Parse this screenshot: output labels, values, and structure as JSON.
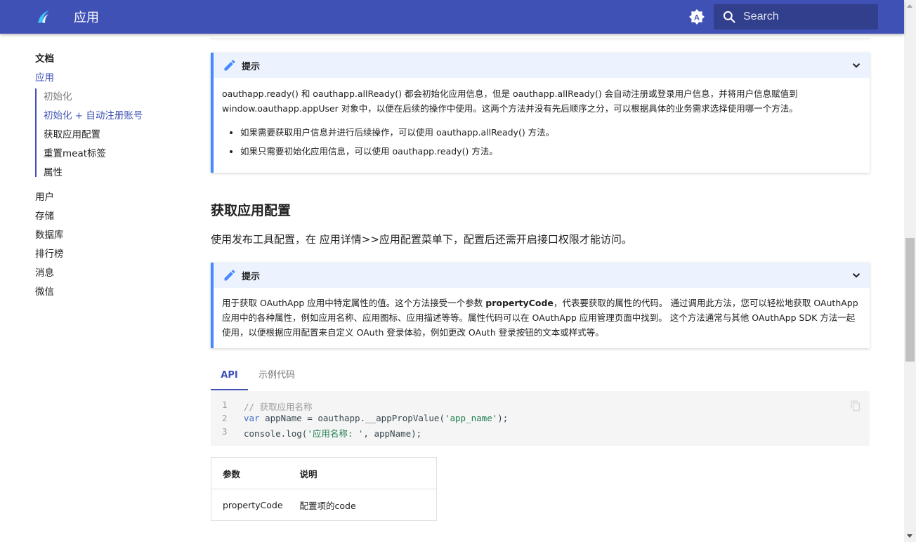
{
  "header": {
    "title": "应用",
    "search_placeholder": "Search",
    "brand_color": "#3f51b5"
  },
  "sidebar": {
    "section_title": "文档",
    "current": "应用",
    "sub_items": [
      "初始化",
      "初始化 + 自动注册账号",
      "获取应用配置",
      "重置meat标签",
      "属性"
    ],
    "items": [
      "用户",
      "存储",
      "数据库",
      "排行榜",
      "消息",
      "微信"
    ]
  },
  "admonition1": {
    "title": "提示",
    "paragraph_line1": "oauthapp.ready() 和 oauthapp.allReady() 都会初始化应用信息，但是 oauthapp.allReady() 会自动注册或登录用户信息，并将用户信息赋值到",
    "paragraph_line2": "window.oauthapp.appUser 对象中，以便在后续的操作中使用。这两个方法并没有先后顺序之分，可以根据具体的业务需求选择使用哪一个方法。",
    "bullets": [
      "如果需要获取用户信息并进行后续操作，可以使用 oauthapp.allReady() 方法。",
      "如果只需要初始化应用信息，可以使用 oauthapp.ready() 方法。"
    ]
  },
  "section": {
    "heading": "获取应用配置",
    "text": "使用发布工具配置，在 应用详情>>应用配置菜单下，配置后还需开启接口权限才能访问。"
  },
  "admonition2": {
    "title": "提示",
    "line1_pre": "用于获取 OAuthApp 应用中特定属性的值。这个方法接受一个参数 ",
    "line1_bold": "propertyCode",
    "line1_post": "，代表要获取的属性的代码。 通过调用此方法，您可以轻松地获取 OAuthApp",
    "line2": "应用中的各种属性，例如应用名称、应用图标、应用描述等等。属性代码可以在 OAuthApp 应用管理页面中找到。 这个方法通常与其他 OAuthApp SDK 方法一起",
    "line3": "使用，以便根据应用配置来自定义 OAuth 登录体验，例如更改 OAuth 登录按钮的文本或样式等。"
  },
  "tabs": [
    "API",
    "示例代码"
  ],
  "code": {
    "line_numbers": [
      "1",
      "2",
      "3"
    ],
    "l1_comment": "// 获取应用名称",
    "l2_kw": "var",
    "l2_mid": " appName = oauthapp.__appPropValue(",
    "l2_str": "'app_name'",
    "l2_end": ");",
    "l3_pre": "console.log(",
    "l3_str": "'应用名称: '",
    "l3_end": ", appName);"
  },
  "table": {
    "headers": [
      "参数",
      "说明"
    ],
    "rows": [
      [
        "propertyCode",
        "配置项的code"
      ]
    ]
  }
}
